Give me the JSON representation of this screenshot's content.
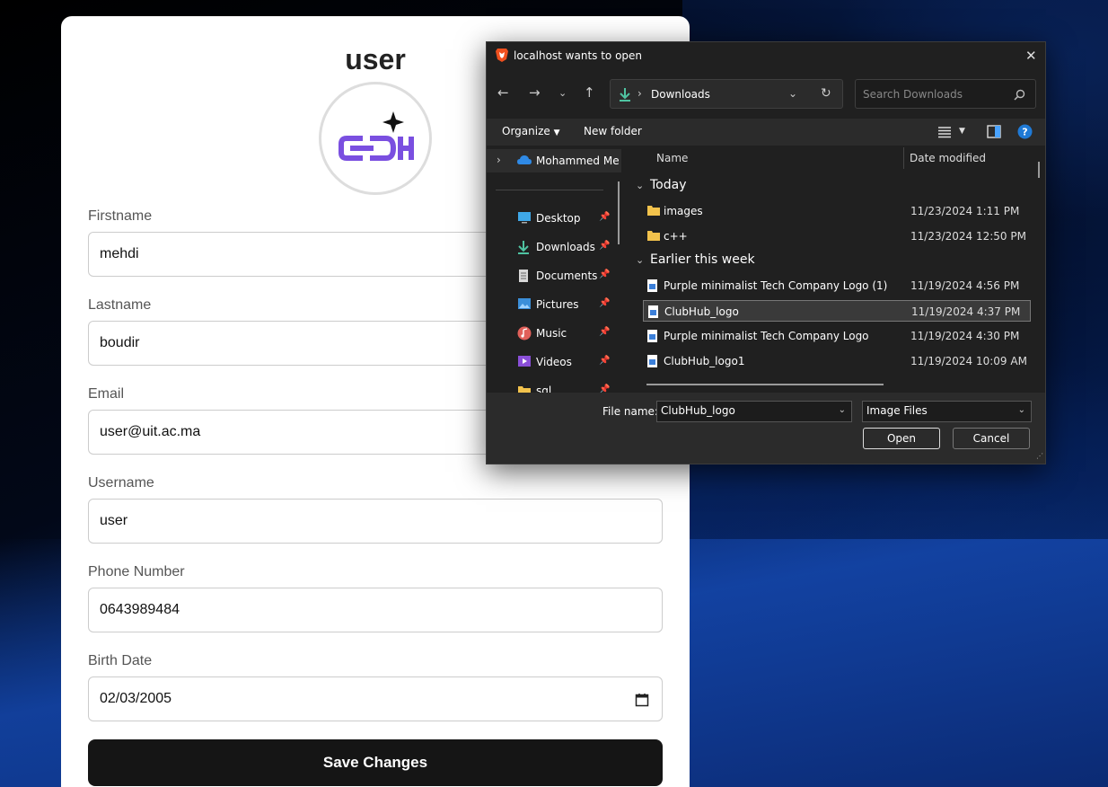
{
  "profile": {
    "title": "user",
    "fields": [
      {
        "label": "Firstname",
        "value": "mehdi"
      },
      {
        "label": "Lastname",
        "value": "boudir"
      },
      {
        "label": "Email",
        "value": "user@uit.ac.ma"
      },
      {
        "label": "Username",
        "value": "user"
      },
      {
        "label": "Phone Number",
        "value": "0643989484"
      },
      {
        "label": "Birth Date",
        "value": "02/03/2005"
      }
    ],
    "save_label": "Save Changes"
  },
  "dialog": {
    "title": "localhost wants to open",
    "address": "Downloads",
    "search_placeholder": "Search Downloads",
    "organize_label": "Organize",
    "new_folder_label": "New folder",
    "nav_items": [
      {
        "label": "Mohammed Me",
        "icon": "onedrive-icon"
      },
      {
        "label": "Desktop",
        "icon": "desktop-icon"
      },
      {
        "label": "Downloads",
        "icon": "download-icon"
      },
      {
        "label": "Documents",
        "icon": "documents-icon"
      },
      {
        "label": "Pictures",
        "icon": "pictures-icon"
      },
      {
        "label": "Music",
        "icon": "music-icon"
      },
      {
        "label": "Videos",
        "icon": "videos-icon"
      },
      {
        "label": "sql",
        "icon": "folder-icon"
      }
    ],
    "columns": {
      "name": "Name",
      "date": "Date modified"
    },
    "groups": [
      {
        "label": "Today",
        "files": [
          {
            "name": "images",
            "date": "11/23/2024 1:11 PM",
            "type": "folder"
          },
          {
            "name": "c++",
            "date": "11/23/2024 12:50 PM",
            "type": "folder"
          }
        ]
      },
      {
        "label": "Earlier this week",
        "files": [
          {
            "name": "Purple minimalist Tech Company Logo (1)",
            "date": "11/19/2024 4:56 PM",
            "type": "image"
          },
          {
            "name": "ClubHub_logo",
            "date": "11/19/2024 4:37 PM",
            "type": "image",
            "selected": true
          },
          {
            "name": "Purple minimalist Tech Company Logo",
            "date": "11/19/2024 4:30 PM",
            "type": "image"
          },
          {
            "name": "ClubHub_logo1",
            "date": "11/19/2024 10:09 AM",
            "type": "image"
          }
        ]
      }
    ],
    "file_name_label": "File name:",
    "file_name_value": "ClubHub_logo",
    "file_type": "Image Files",
    "open_label": "Open",
    "cancel_label": "Cancel"
  }
}
